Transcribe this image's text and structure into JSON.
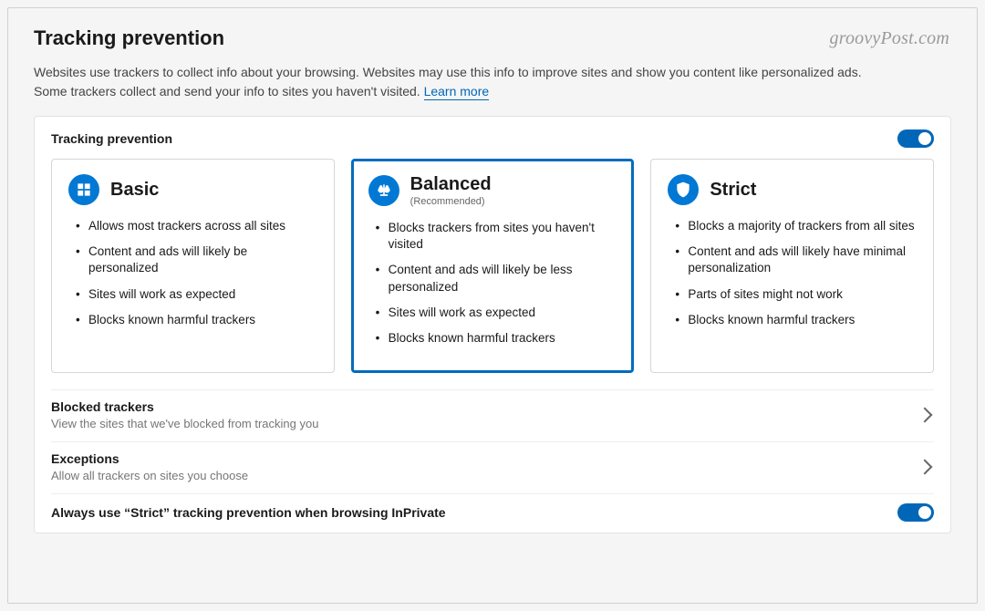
{
  "watermark": "groovyPost.com",
  "page_title": "Tracking prevention",
  "intro_text": "Websites use trackers to collect info about your browsing. Websites may use this info to improve sites and show you content like personalized ads. Some trackers collect and send your info to sites you haven't visited. ",
  "learn_more": "Learn more",
  "section_label": "Tracking prevention",
  "toggle_on": true,
  "levels": {
    "basic": {
      "title": "Basic",
      "subtitle": "",
      "bullets": [
        "Allows most trackers across all sites",
        "Content and ads will likely be personalized",
        "Sites will work as expected",
        "Blocks known harmful trackers"
      ]
    },
    "balanced": {
      "title": "Balanced",
      "subtitle": "(Recommended)",
      "bullets": [
        "Blocks trackers from sites you haven't visited",
        "Content and ads will likely be less personalized",
        "Sites will work as expected",
        "Blocks known harmful trackers"
      ]
    },
    "strict": {
      "title": "Strict",
      "subtitle": "",
      "bullets": [
        "Blocks a majority of trackers from all sites",
        "Content and ads will likely have minimal personalization",
        "Parts of sites might not work",
        "Blocks known harmful trackers"
      ]
    }
  },
  "rows": {
    "blocked": {
      "title": "Blocked trackers",
      "desc": "View the sites that we've blocked from tracking you"
    },
    "exceptions": {
      "title": "Exceptions",
      "desc": "Allow all trackers on sites you choose"
    }
  },
  "inprivate_label": "Always use “Strict” tracking prevention when browsing InPrivate",
  "inprivate_on": true,
  "colors": {
    "accent": "#0067b8"
  }
}
